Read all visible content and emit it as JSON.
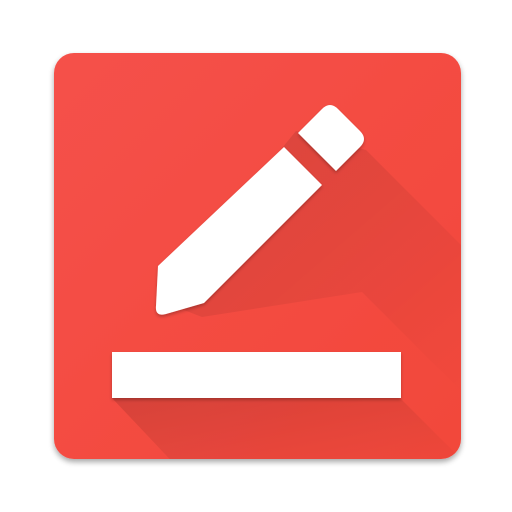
{
  "icon": {
    "semantic": "edit-pencil-icon",
    "underline": "text-underline-bar",
    "colors": {
      "background": "#f44336",
      "background_light": "#f5514a",
      "long_shadow": "#c62828",
      "glyph": "#ffffff"
    }
  }
}
